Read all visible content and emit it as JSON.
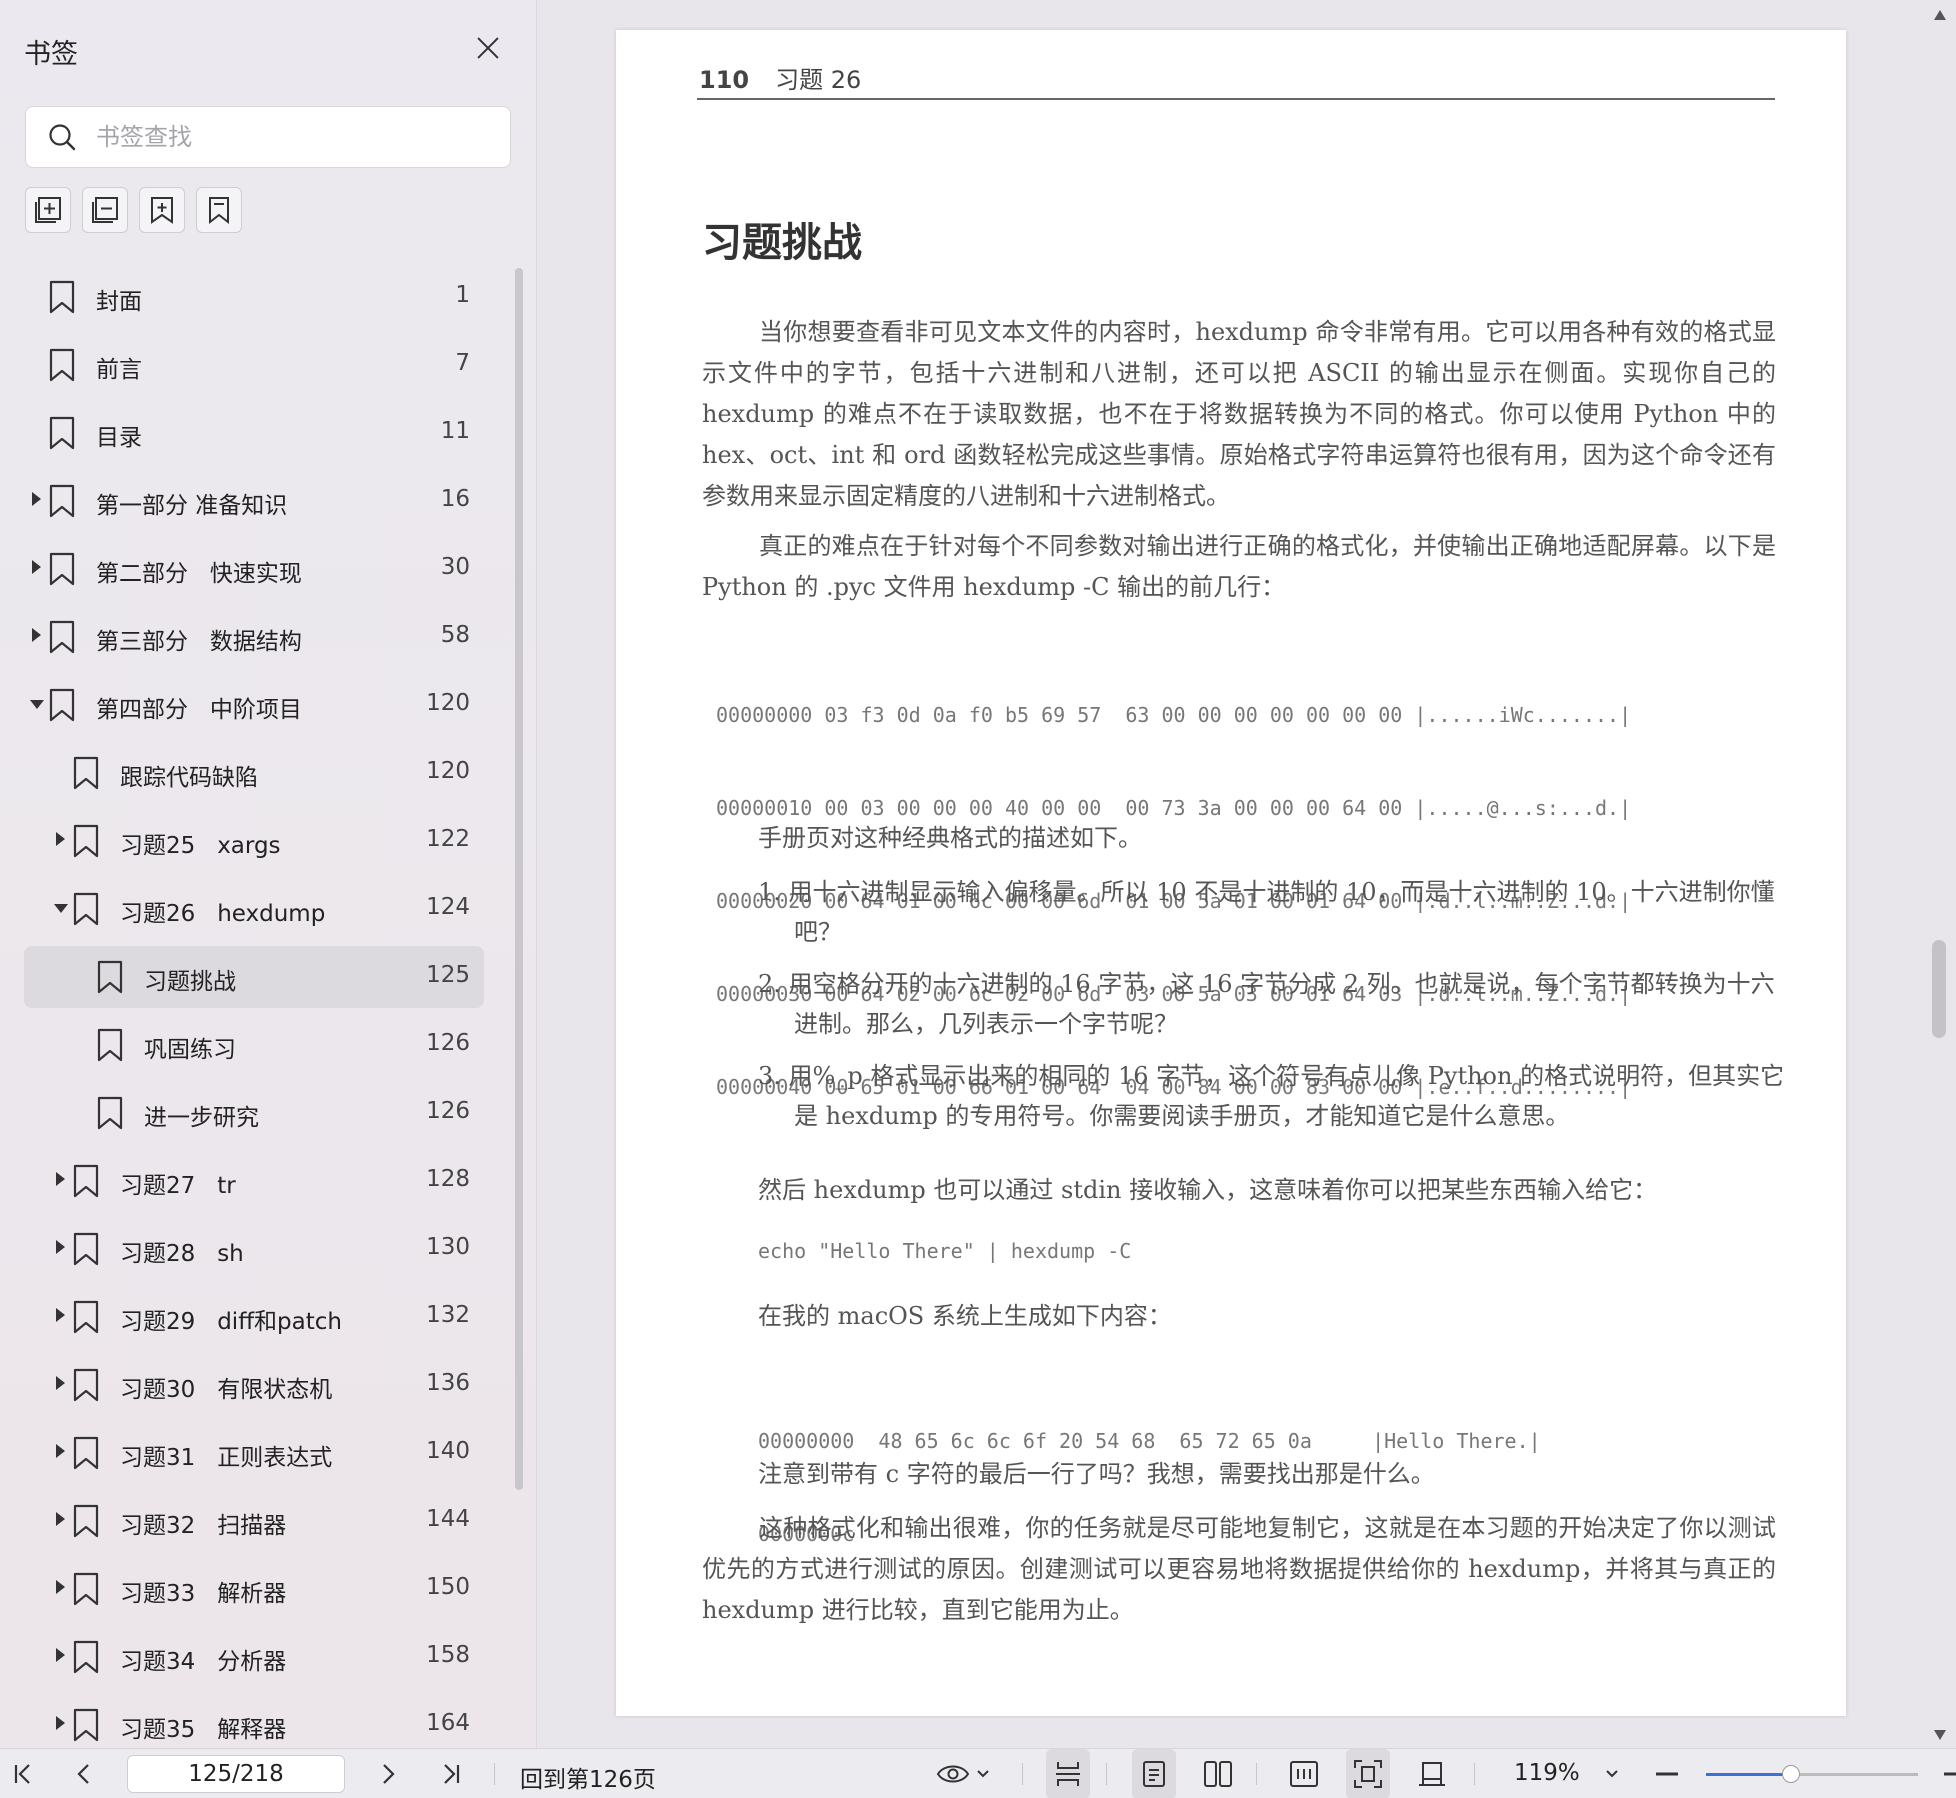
{
  "sidebar": {
    "title": "书签",
    "search_placeholder": "书签查找",
    "tool_icons": [
      "expand-all-icon",
      "collapse-all-icon",
      "add-bookmark-icon",
      "bookmark-icon"
    ],
    "items": [
      {
        "label": "封面",
        "page": "1",
        "level": 0,
        "arrow": ""
      },
      {
        "label": "前言",
        "page": "7",
        "level": 0,
        "arrow": ""
      },
      {
        "label": "目录",
        "page": "11",
        "level": 0,
        "arrow": ""
      },
      {
        "label": "第一部分 准备知识",
        "page": "16",
        "level": 0,
        "arrow": "right"
      },
      {
        "label": "第二部分   快速实现",
        "page": "30",
        "level": 0,
        "arrow": "right"
      },
      {
        "label": "第三部分   数据结构",
        "page": "58",
        "level": 0,
        "arrow": "right"
      },
      {
        "label": "第四部分   中阶项目",
        "page": "120",
        "level": 0,
        "arrow": "down"
      },
      {
        "label": "跟踪代码缺陷",
        "page": "120",
        "level": 1,
        "arrow": ""
      },
      {
        "label": "习题25   xargs",
        "page": "122",
        "level": 1,
        "arrow": "right"
      },
      {
        "label": "习题26   hexdump",
        "page": "124",
        "level": 1,
        "arrow": "down"
      },
      {
        "label": "习题挑战",
        "page": "125",
        "level": 2,
        "arrow": "",
        "selected": true
      },
      {
        "label": "巩固练习",
        "page": "126",
        "level": 2,
        "arrow": ""
      },
      {
        "label": "进一步研究",
        "page": "126",
        "level": 2,
        "arrow": ""
      },
      {
        "label": "习题27   tr",
        "page": "128",
        "level": 1,
        "arrow": "right"
      },
      {
        "label": "习题28   sh",
        "page": "130",
        "level": 1,
        "arrow": "right"
      },
      {
        "label": "习题29   diff和patch",
        "page": "132",
        "level": 1,
        "arrow": "right"
      },
      {
        "label": "习题30   有限状态机",
        "page": "136",
        "level": 1,
        "arrow": "right"
      },
      {
        "label": "习题31   正则表达式",
        "page": "140",
        "level": 1,
        "arrow": "right"
      },
      {
        "label": "习题32   扫描器",
        "page": "144",
        "level": 1,
        "arrow": "right"
      },
      {
        "label": "习题33   解析器",
        "page": "150",
        "level": 1,
        "arrow": "right"
      },
      {
        "label": "习题34   分析器",
        "page": "158",
        "level": 1,
        "arrow": "right"
      },
      {
        "label": "习题35   解释器",
        "page": "164",
        "level": 1,
        "arrow": "right"
      }
    ]
  },
  "document": {
    "page_number": "110",
    "header_title": "习题 26",
    "heading": "习题挑战",
    "para1": "当你想要查看非可见文本文件的内容时，hexdump 命令非常有用。它可以用各种有效的格式显示文件中的字节，包括十六进制和八进制，还可以把 ASCII 的输出显示在侧面。实现你自己的 hexdump 的难点不在于读取数据，也不在于将数据转换为不同的格式。你可以使用 Python 中的 hex、oct、int 和 ord 函数轻松完成这些事情。原始格式字符串运算符也很有用，因为这个命令还有参数用来显示固定精度的八进制和十六进制格式。",
    "para2": "真正的难点在于针对每个不同参数对输出进行正确的格式化，并使输出正确地适配屏幕。以下是 Python 的 .pyc 文件用 hexdump -C 输出的前几行：",
    "hexdump1": [
      "00000000 03 f3 0d 0a f0 b5 69 57  63 00 00 00 00 00 00 00 |......iWc.......|",
      "00000010 00 03 00 00 00 40 00 00  00 73 3a 00 00 00 64 00 |.....@...s:...d.|",
      "00000020 00 64 01 00 6c 00 00 6d  01 00 5a 01 00 01 64 00 |.d..l..m..Z...d.|",
      "00000030 00 64 02 00 6c 02 00 6d  03 00 5a 03 00 01 64 03 |.d..l..m..Z...d.|",
      "00000040 00 65 01 00 66 01 00 64  04 00 84 00 00 83 00 00 |.e..f..d........|"
    ],
    "manual_intro": "手册页对这种经典格式的描述如下。",
    "list": [
      "1. 用十六进制显示输入偏移量。所以 10 不是十进制的 10，而是十六进制的 10。十六进制你懂吧？",
      "2. 用空格分开的十六进制的 16 字节，这 16 字节分成 2 列。也就是说，每个字节都转换为十六进制。那么，几列表示一个字节呢？",
      "3. 用%_p 格式显示出来的相同的 16 字节，这个符号有点儿像 Python 的格式说明符，但其实它是 hexdump 的专用符号。你需要阅读手册页，才能知道它是什么意思。"
    ],
    "stdin_line": "然后 hexdump 也可以通过 stdin 接收输入，这意味着你可以把某些东西输入给它：",
    "echo_cmd": "echo \"Hello There\" | hexdump -C",
    "macos_line": "在我的 macOS 系统上生成如下内容：",
    "hexdump2": [
      "00000000  48 65 6c 6c 6f 20 54 68  65 72 65 0a     |Hello There.|",
      "0000000c"
    ],
    "note_line": "注意到带有 c 字符的最后一行了吗？我想，需要找出那是什么。",
    "para3": "这种格式化和输出很难，你的任务就是尽可能地复制它，这就是在本习题的开始决定了你以测试优先的方式进行测试的原因。创建测试可以更容易地将数据提供给你的 hexdump，并将其与真正的 hexdump 进行比较，直到它能用为止。"
  },
  "toolbar": {
    "page_input": "125/218",
    "back_to": "回到第126页",
    "zoom": "119%",
    "zoom_fraction": 0.4
  }
}
